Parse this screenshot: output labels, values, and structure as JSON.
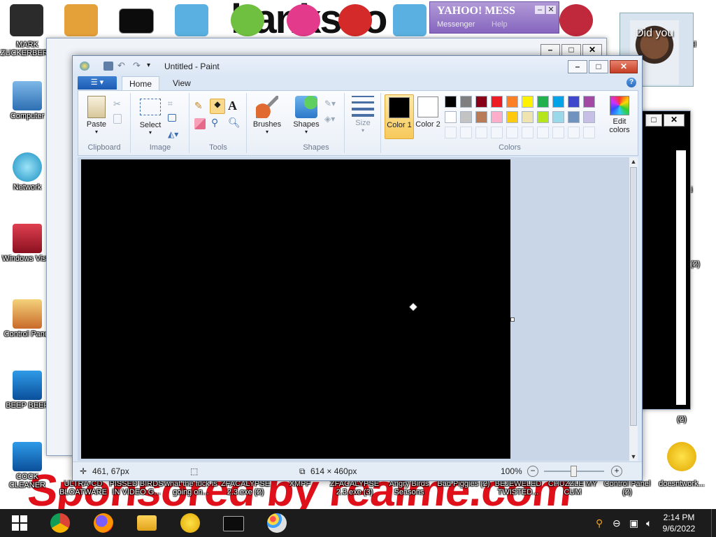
{
  "desktop": {
    "wallpaper_top": "hanks to",
    "wallpaper_bottom": "Sponsored by realme.com",
    "icons_left": [
      {
        "label": "MARK ZUCKERBERG"
      },
      {
        "label": "Computer"
      },
      {
        "label": "Network"
      },
      {
        "label": "Windows Vista"
      },
      {
        "label": "Control Panel"
      },
      {
        "label": "BEEP BEEP"
      },
      {
        "label": "COCK CLEANER"
      }
    ],
    "icons_bottom": [
      {
        "label": "ULTRA-CD BLOATWARE"
      },
      {
        "label": "PISSED BIRDS IN VIDEO G..."
      },
      {
        "label": "what the fuck is going on..."
      },
      {
        "label": "ZFACALYPSE 2.3.exe (2)"
      },
      {
        "label": "XMPF"
      },
      {
        "label": "ZFACALYPSE 2.3.exe (3)"
      },
      {
        "label": "Angry Birds Seasons"
      },
      {
        "label": "Bad Piggies (2)"
      },
      {
        "label": "BEJEWELED TWISTED..."
      },
      {
        "label": "CHUZZLE MY CUM"
      },
      {
        "label": "Control Panel (2)"
      },
      {
        "label": "doesntwork..."
      }
    ],
    "icons_right": [
      {
        "label": "anel"
      },
      {
        "label": "ini"
      },
      {
        "label": "RS (2)"
      },
      {
        "label": "(2)"
      }
    ]
  },
  "yahoo": {
    "title": "YAHOO! MESS",
    "sub": "Messenger",
    "help": "Help"
  },
  "notification": {
    "text": "Did you"
  },
  "paint": {
    "title": "Untitled - Paint",
    "tabs": {
      "home": "Home",
      "view": "View"
    },
    "clipboard": {
      "paste": "Paste",
      "group": "Clipboard"
    },
    "image": {
      "select": "Select",
      "group": "Image"
    },
    "tools": {
      "group": "Tools",
      "text_tool": "A"
    },
    "brushes": {
      "label": "Brushes"
    },
    "shapes": {
      "label": "Shapes",
      "group": "Shapes"
    },
    "size": {
      "label": "Size"
    },
    "colors": {
      "color1": "Color 1",
      "color1_value": "#000000",
      "color2": "Color 2",
      "color2_value": "#ffffff",
      "edit": "Edit colors",
      "group": "Colors",
      "palette_row1": [
        "#000000",
        "#7f7f7f",
        "#880015",
        "#ed1c24",
        "#ff7f27",
        "#fff200",
        "#22b14c",
        "#00a2e8",
        "#3f48cc",
        "#a349a4"
      ],
      "palette_row2": [
        "#ffffff",
        "#c3c3c3",
        "#b97a57",
        "#ffaec9",
        "#ffc90e",
        "#efe4b0",
        "#b5e61d",
        "#99d9ea",
        "#7092be",
        "#c8bfe7"
      ]
    },
    "status": {
      "cursor_pos": "461, 67px",
      "canvas_size": "614 × 460px",
      "zoom": "100%"
    }
  },
  "taskbar": {
    "clock_time": "2:14 PM",
    "clock_date": "9/6/2022",
    "apps": [
      "start",
      "chrome",
      "firefox",
      "file-explorer",
      "yahoo-messenger",
      "cmd",
      "paint"
    ]
  }
}
